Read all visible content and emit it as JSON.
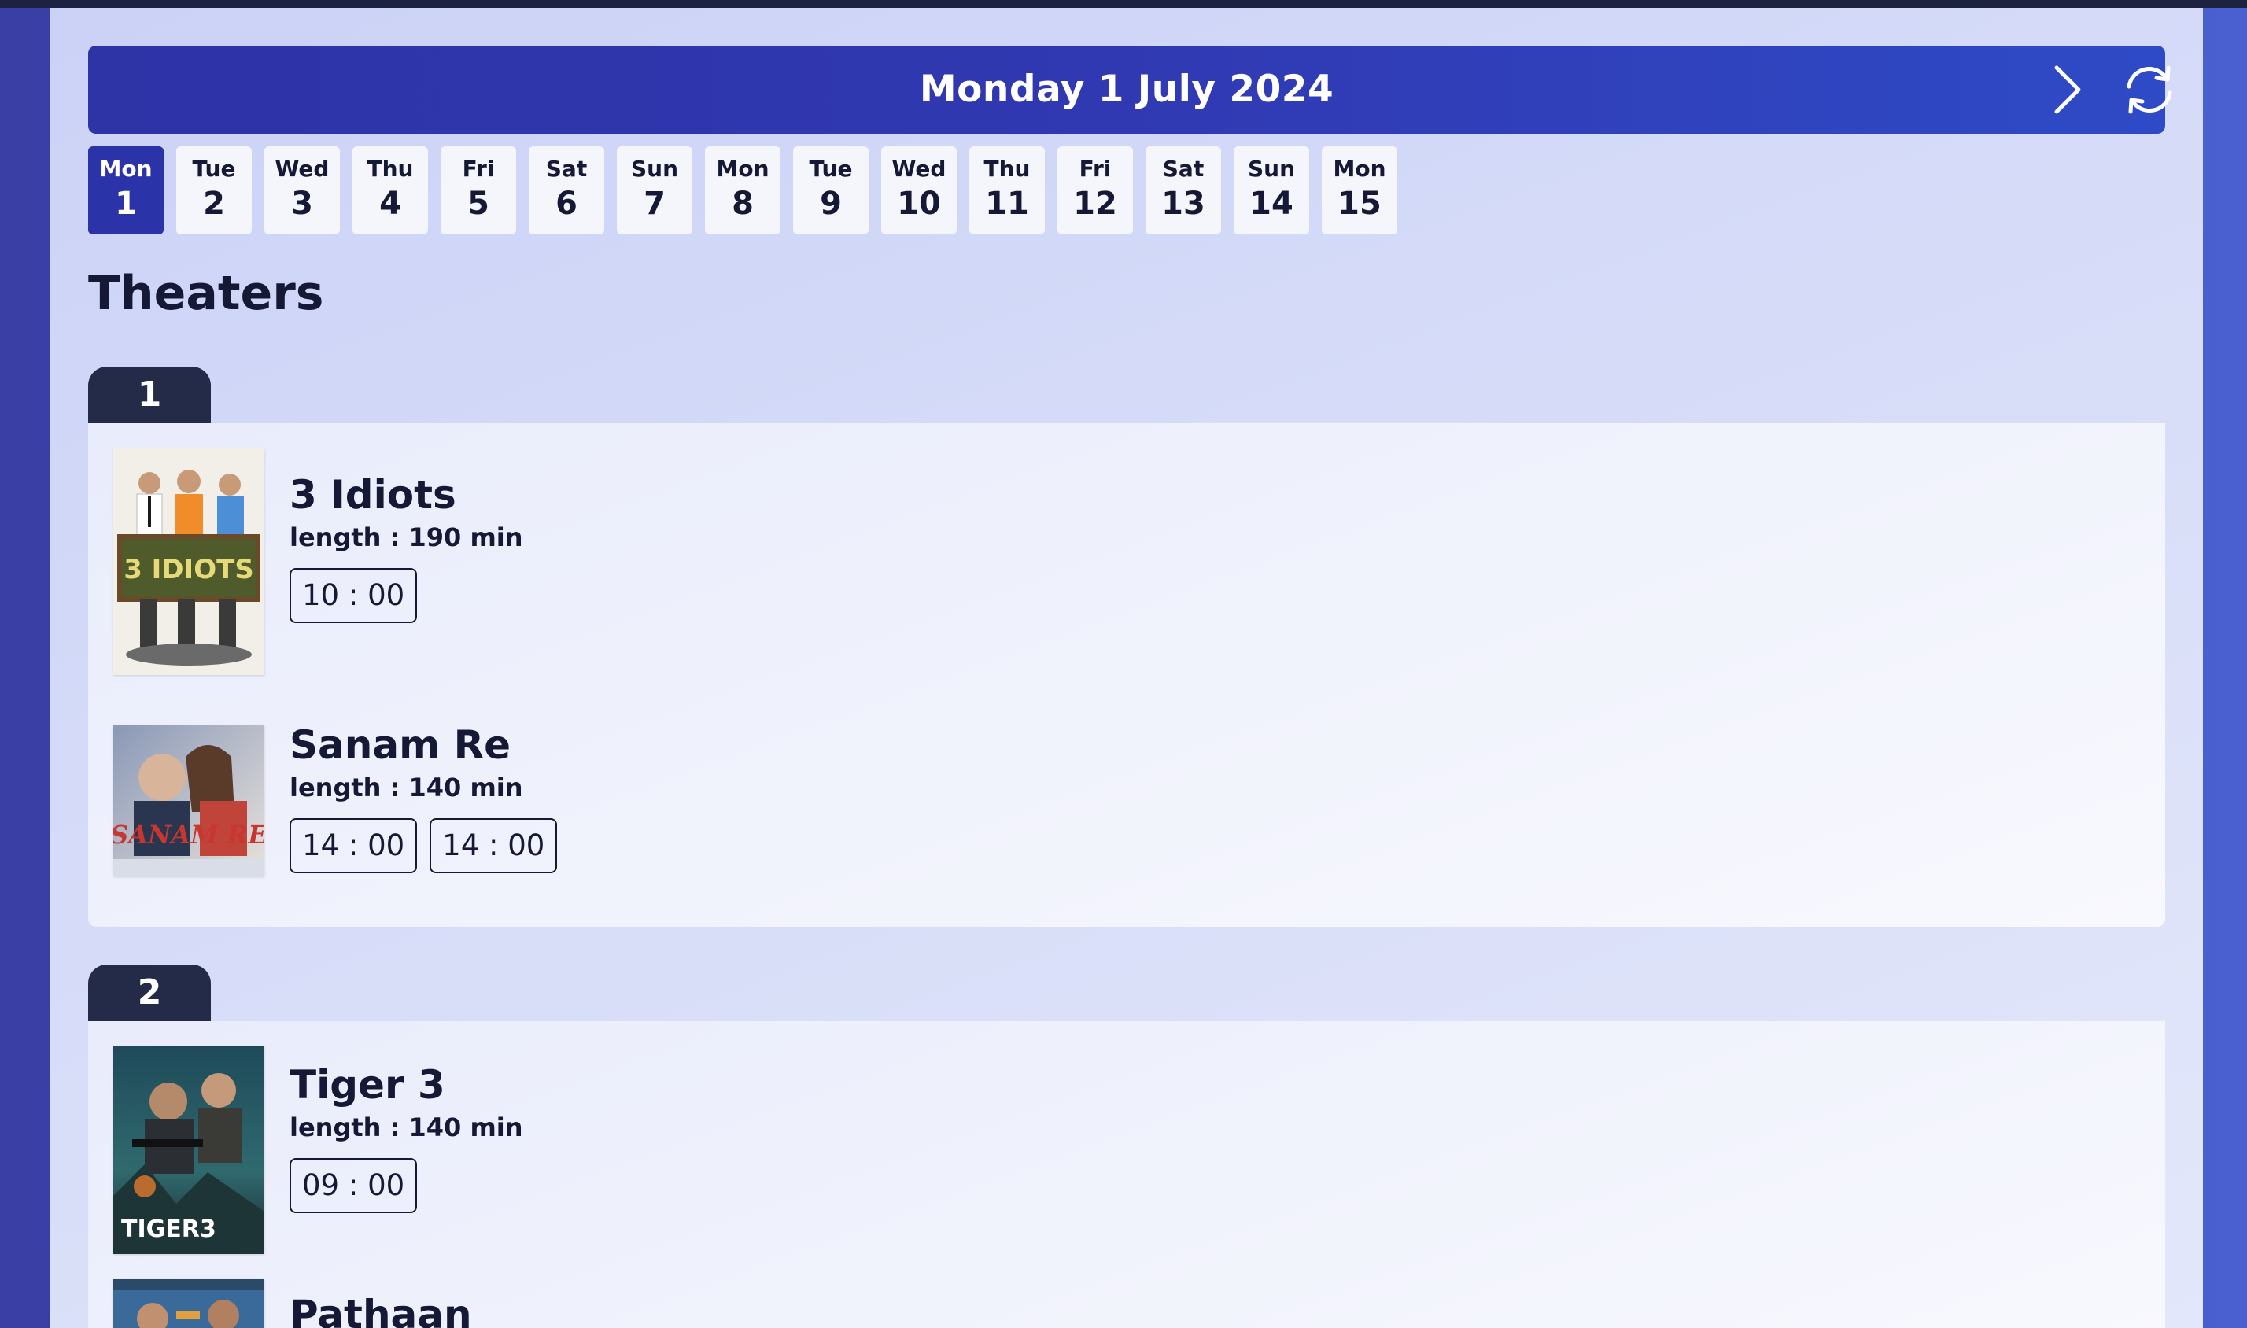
{
  "header": {
    "title": "Monday 1 July 2024",
    "next_icon": "chevron-right-icon",
    "refresh_icon": "refresh-icon"
  },
  "days": [
    {
      "name": "Mon",
      "num": "1",
      "active": true
    },
    {
      "name": "Tue",
      "num": "2"
    },
    {
      "name": "Wed",
      "num": "3"
    },
    {
      "name": "Thu",
      "num": "4"
    },
    {
      "name": "Fri",
      "num": "5"
    },
    {
      "name": "Sat",
      "num": "6"
    },
    {
      "name": "Sun",
      "num": "7"
    },
    {
      "name": "Mon",
      "num": "8"
    },
    {
      "name": "Tue",
      "num": "9"
    },
    {
      "name": "Wed",
      "num": "10"
    },
    {
      "name": "Thu",
      "num": "11"
    },
    {
      "name": "Fri",
      "num": "12"
    },
    {
      "name": "Sat",
      "num": "13"
    },
    {
      "name": "Sun",
      "num": "14"
    },
    {
      "name": "Mon",
      "num": "15"
    }
  ],
  "section_title": "Theaters",
  "theaters": [
    {
      "label": "1",
      "movies": [
        {
          "title": "3 Idiots",
          "length_label": "length : ",
          "length": "190 min",
          "times": [
            "10 : 00"
          ]
        },
        {
          "title": "Sanam Re",
          "length_label": "length : ",
          "length": "140 min",
          "times": [
            "14 : 00",
            "14 : 00"
          ]
        }
      ]
    },
    {
      "label": "2",
      "movies": [
        {
          "title": "Tiger 3",
          "length_label": "length : ",
          "length": "140 min",
          "times": [
            "09 : 00"
          ]
        },
        {
          "title": "Pathaan",
          "length_label": "length : ",
          "length": "",
          "times": []
        }
      ]
    }
  ],
  "colors": {
    "accent": "#2e33a6",
    "tab": "#242b49",
    "text": "#151935"
  }
}
